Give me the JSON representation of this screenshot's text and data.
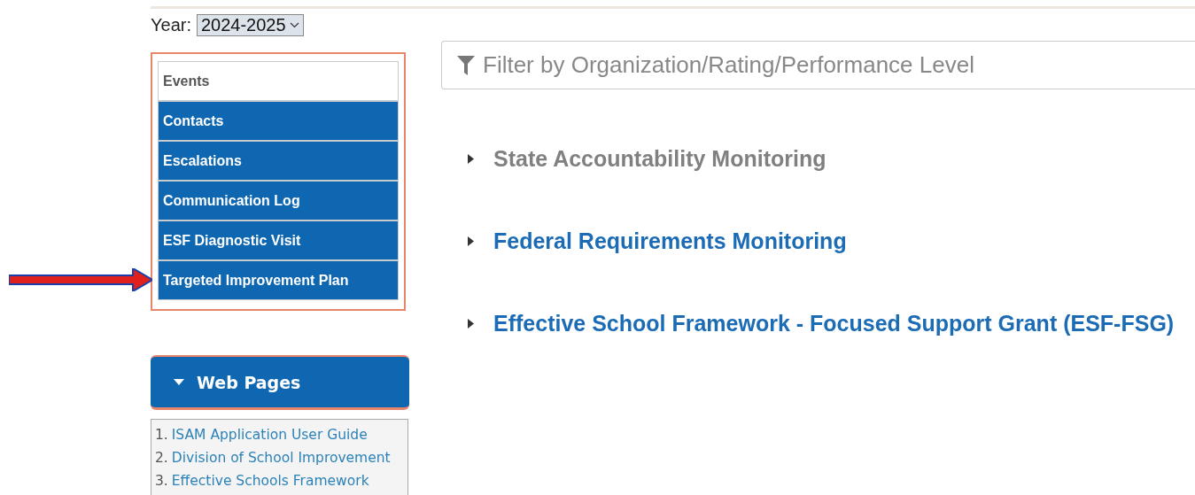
{
  "year": {
    "label": "Year:",
    "value": "2024-2025"
  },
  "nav": [
    {
      "label": "Events",
      "selected": true
    },
    {
      "label": "Contacts",
      "selected": false
    },
    {
      "label": "Escalations",
      "selected": false
    },
    {
      "label": "Communication Log",
      "selected": false
    },
    {
      "label": "ESF Diagnostic Visit",
      "selected": false
    },
    {
      "label": "Targeted Improvement Plan",
      "selected": false
    }
  ],
  "web_pages": {
    "title": "Web Pages",
    "expanded": true,
    "links": [
      {
        "number": "1.",
        "label": "ISAM Application User Guide"
      },
      {
        "number": "2.",
        "label": "Division of School Improvement"
      },
      {
        "number": "3.",
        "label": "Effective Schools Framework"
      }
    ]
  },
  "filter": {
    "placeholder": "Filter by Organization/Rating/Performance Level"
  },
  "sections": [
    {
      "title": "State Accountability Monitoring",
      "color": "#808080"
    },
    {
      "title": "Federal Requirements Monitoring",
      "color": "#1b6bb5"
    },
    {
      "title": "Effective School Framework - Focused Support Grant (ESF-FSG)",
      "color": "#1b6bb5"
    }
  ]
}
